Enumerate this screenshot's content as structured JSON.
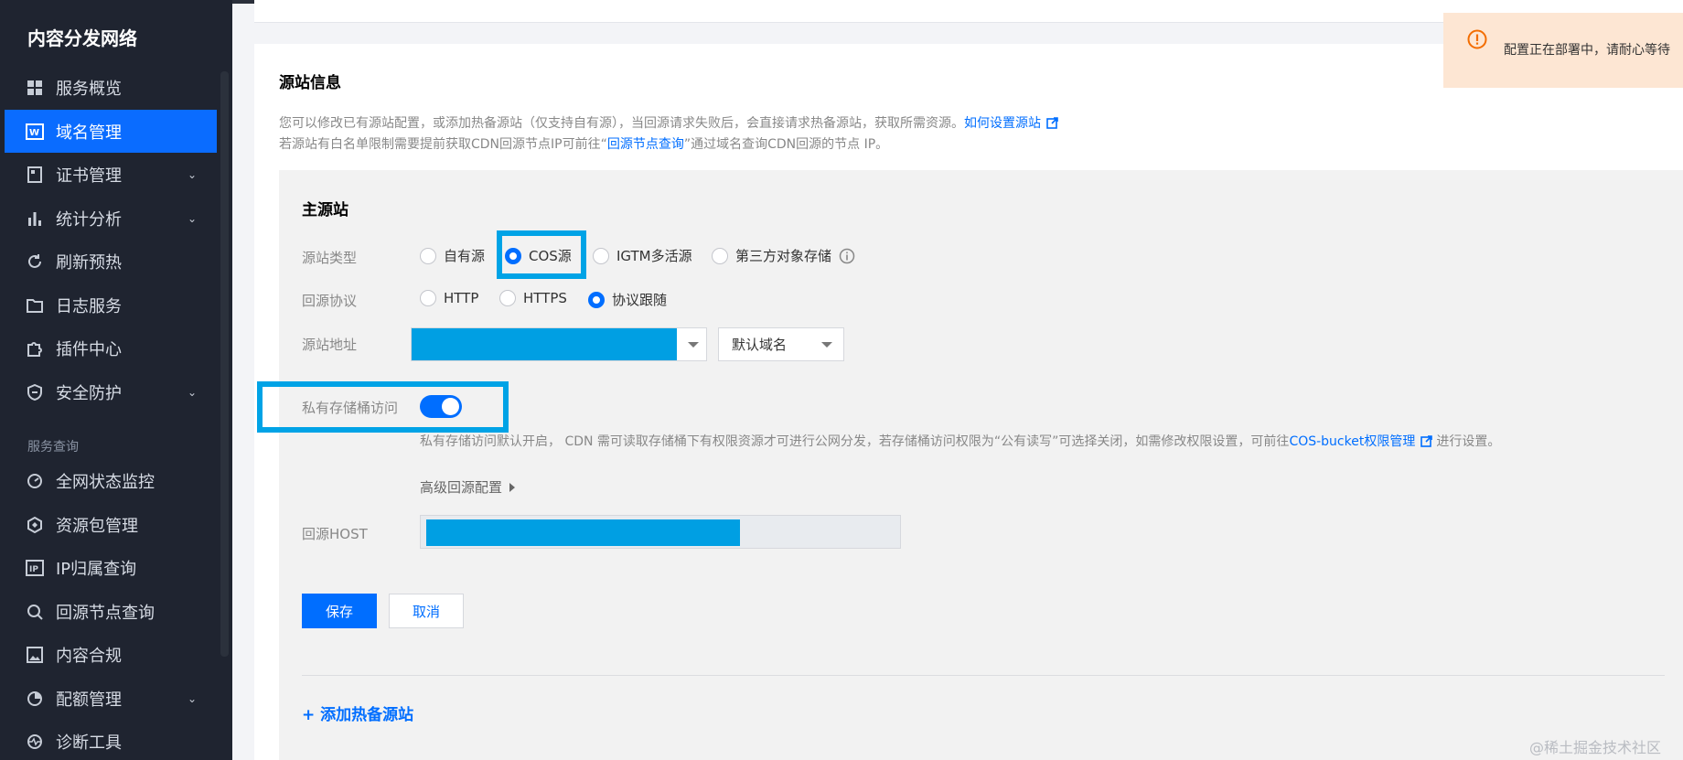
{
  "sidebar": {
    "brand": "内容分发网络",
    "items": [
      {
        "label": "服务概览",
        "icon": "grid-icon"
      },
      {
        "label": "域名管理",
        "icon": "domain-icon"
      },
      {
        "label": "证书管理",
        "icon": "certificate-icon"
      },
      {
        "label": "统计分析",
        "icon": "bar-chart-icon"
      },
      {
        "label": "刷新预热",
        "icon": "refresh-icon"
      },
      {
        "label": "日志服务",
        "icon": "folder-icon"
      },
      {
        "label": "插件中心",
        "icon": "puzzle-icon"
      },
      {
        "label": "安全防护",
        "icon": "shield-icon"
      },
      {
        "label": "全网状态监控",
        "icon": "monitor-icon"
      },
      {
        "label": "资源包管理",
        "icon": "package-icon"
      },
      {
        "label": "IP归属查询",
        "icon": "ip-icon"
      },
      {
        "label": "回源节点查询",
        "icon": "search-icon"
      },
      {
        "label": "内容合规",
        "icon": "image-icon"
      },
      {
        "label": "配额管理",
        "icon": "pie-chart-icon"
      },
      {
        "label": "诊断工具",
        "icon": "pulse-icon"
      }
    ],
    "section_label": "服务查询",
    "active_item": "域名管理"
  },
  "origin": {
    "title": "源站信息",
    "desc_line1": "您可以修改已有源站配置，或添加热备源站（仅支持自有源），当回源请求失败后，会直接请求热备源站，获取所需资源。",
    "desc_link1": "如何设置源站",
    "desc_line2_pre": "若源站有白名单限制需要提前获取CDN回源节点IP可前往“",
    "desc_link2": "回源节点查询",
    "desc_line2_post": "”通过域名查询CDN回源的节点 IP。"
  },
  "primary": {
    "title": "主源站",
    "type_label": "源站类型",
    "type_options": [
      "自有源",
      "COS源",
      "IGTM多活源",
      "第三方对象存储"
    ],
    "type_selected": "COS源",
    "protocol_label": "回源协议",
    "protocol_options": [
      "HTTP",
      "HTTPS",
      "协议跟随"
    ],
    "protocol_selected": "协议跟随",
    "address_label": "源站地址",
    "domain_select": "默认域名",
    "private_label": "私有存储桶访问",
    "private_enabled": true,
    "hint_pre": "私有存储访问默认开启， CDN 需可读取存储桶下有权限资源才可进行公网分发，若存储桶访问权限为“公有读写”可选择关闭，如需修改权限设置，可前往",
    "hint_link": "COS-bucket权限管理",
    "hint_post": "进行设置。",
    "advanced": "高级回源配置",
    "host_label": "回源HOST"
  },
  "buttons": {
    "save": "保存",
    "cancel": "取消",
    "add_backup": "+ 添加热备源站"
  },
  "toast": {
    "message": "配置正在部署中，请耐心等待"
  },
  "watermark": "@稀土掘金技术社区",
  "colors": {
    "accent": "#006eff",
    "sidebar_bg": "#1f2430",
    "highlight": "#00a3e6",
    "toast_bg": "#fde6d3",
    "toast_icon": "#f36d00"
  }
}
